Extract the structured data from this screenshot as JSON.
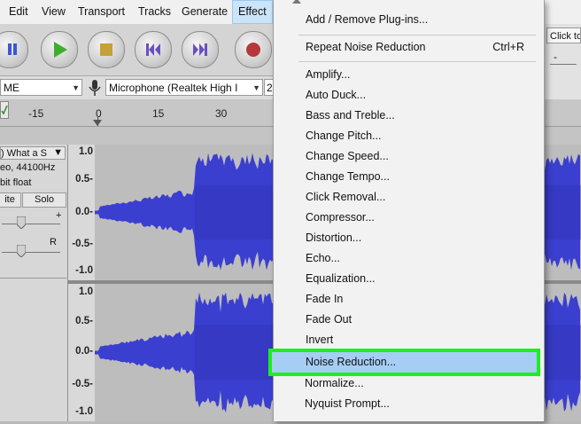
{
  "menubar": {
    "items": [
      "Edit",
      "View",
      "Transport",
      "Tracks",
      "Generate",
      "Effect"
    ]
  },
  "devicebar": {
    "host_value": "ME",
    "recording_device": "Microphone (Realtek High I",
    "channels": "2"
  },
  "ruler": {
    "labels": [
      "-15",
      "0",
      "15",
      "30"
    ]
  },
  "track": {
    "name": ") What a S",
    "info_line1": "eo, 44100Hz",
    "info_line2": "bit float",
    "mute_label": "ite",
    "solo_label": "Solo",
    "gain_plus": "+",
    "pan_right": "R"
  },
  "scale": {
    "upper": [
      "1.0",
      "0.5-",
      "0.0-",
      "-0.5-",
      "-1.0"
    ],
    "lower": [
      "1.0",
      "0.5-",
      "0.0-",
      "-0.5-",
      "-1.0"
    ]
  },
  "rightbar": {
    "click_to": "Click to",
    "dash": "-"
  },
  "effect_menu": {
    "items": [
      {
        "label": "Add / Remove Plug-ins...",
        "shortcut": ""
      },
      {
        "label": "Repeat Noise Reduction",
        "shortcut": "Ctrl+R"
      },
      {
        "label": "Amplify...",
        "shortcut": ""
      },
      {
        "label": "Auto Duck...",
        "shortcut": ""
      },
      {
        "label": "Bass and Treble...",
        "shortcut": ""
      },
      {
        "label": "Change Pitch...",
        "shortcut": ""
      },
      {
        "label": "Change Speed...",
        "shortcut": ""
      },
      {
        "label": "Change Tempo...",
        "shortcut": ""
      },
      {
        "label": "Click Removal...",
        "shortcut": ""
      },
      {
        "label": "Compressor...",
        "shortcut": ""
      },
      {
        "label": "Distortion...",
        "shortcut": ""
      },
      {
        "label": "Echo...",
        "shortcut": ""
      },
      {
        "label": "Equalization...",
        "shortcut": ""
      },
      {
        "label": "Fade In",
        "shortcut": ""
      },
      {
        "label": "Fade Out",
        "shortcut": ""
      },
      {
        "label": "Invert",
        "shortcut": ""
      },
      {
        "label": "Noise Reduction...",
        "shortcut": ""
      },
      {
        "label": "Normalize...",
        "shortcut": ""
      },
      {
        "label": "Nyquist Prompt...",
        "shortcut": ""
      }
    ],
    "highlighted_item": "Noise Reduction..."
  },
  "colors": {
    "waveform": "#3b3fcf",
    "waveform_dark": "#2a2eb0",
    "highlight_border": "#1dee1d",
    "selection": "#a6cdf4"
  }
}
